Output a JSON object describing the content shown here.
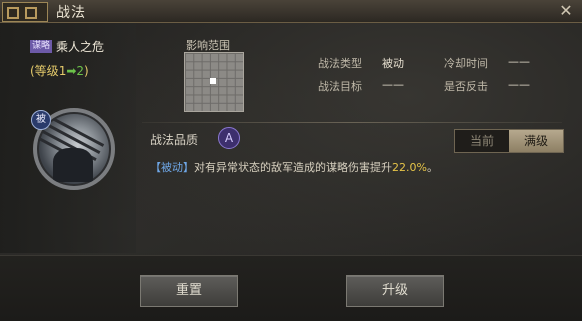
{
  "window": {
    "title": "战法",
    "close_icon": "close-icon"
  },
  "skill": {
    "type_tag": "谋略",
    "name": "乘人之危",
    "level_prefix": "(等级",
    "level_from": "1",
    "level_arrow": "➡",
    "level_to": "2",
    "level_suffix": ")",
    "badge": "被"
  },
  "range": {
    "label": "影响范围"
  },
  "info": {
    "type_label": "战法类型",
    "type_value": "被动",
    "cooldown_label": "冷却时间",
    "cooldown_value": "——",
    "target_label": "战法目标",
    "target_value": "——",
    "counter_label": "是否反击",
    "counter_value": "——"
  },
  "quality": {
    "label": "战法品质",
    "grade": "A"
  },
  "toggle": {
    "current": "当前",
    "max": "满级"
  },
  "description": {
    "tag": "【被动】",
    "text_before": "对有异常状态的敌军造成的谋略伤害提升",
    "value": "22.0%",
    "text_after": "。"
  },
  "buttons": {
    "reset": "重置",
    "upgrade": "升级"
  },
  "colors": {
    "accent_gold": "#e7c548",
    "level_green": "#6cc24a",
    "passive_blue": "#6fa8e8",
    "tag_purple": "#6d5aa8"
  }
}
